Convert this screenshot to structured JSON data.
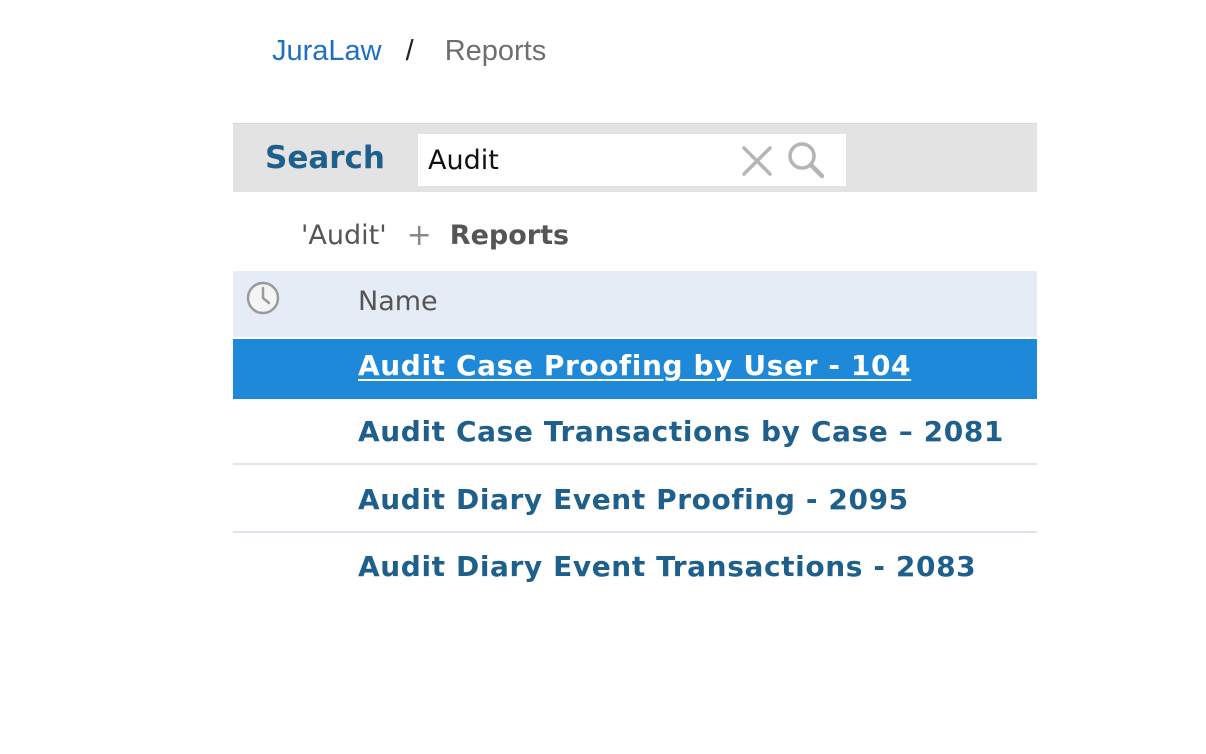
{
  "breadcrumb": {
    "home": "JuraLaw",
    "separator": "/",
    "current": "Reports"
  },
  "search": {
    "label": "Search",
    "value": "Audit",
    "clear_icon": "close-icon",
    "search_icon": "search-icon"
  },
  "filter": {
    "term": "'Audit'",
    "plus": "+",
    "scope": "Reports"
  },
  "table": {
    "recent_icon": "clock-icon",
    "column_name": "Name",
    "rows": [
      {
        "label": "Audit Case Proofing by User - 104",
        "selected": true
      },
      {
        "label": "Audit Case Transactions by Case – 2081",
        "selected": false
      },
      {
        "label": "Audit Diary Event Proofing - 2095",
        "selected": false
      },
      {
        "label": "Audit Diary Event Transactions - 2083",
        "selected": false
      }
    ]
  },
  "colors": {
    "accent": "#1d89d8",
    "link": "#1e5f8c",
    "breadcrumb_link": "#1f6fc4"
  }
}
